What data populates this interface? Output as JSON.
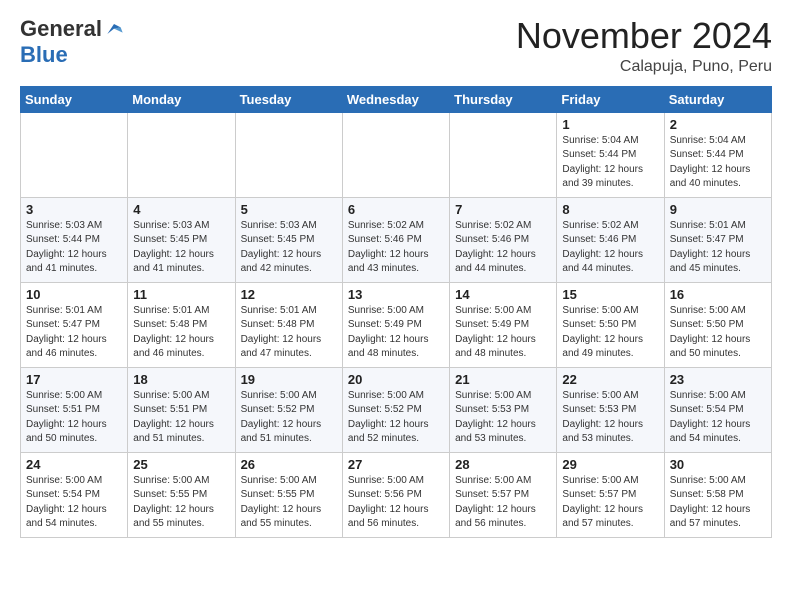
{
  "logo": {
    "general": "General",
    "blue": "Blue"
  },
  "header": {
    "month": "November 2024",
    "location": "Calapuja, Puno, Peru"
  },
  "weekdays": [
    "Sunday",
    "Monday",
    "Tuesday",
    "Wednesday",
    "Thursday",
    "Friday",
    "Saturday"
  ],
  "weeks": [
    [
      {
        "day": "",
        "info": ""
      },
      {
        "day": "",
        "info": ""
      },
      {
        "day": "",
        "info": ""
      },
      {
        "day": "",
        "info": ""
      },
      {
        "day": "",
        "info": ""
      },
      {
        "day": "1",
        "info": "Sunrise: 5:04 AM\nSunset: 5:44 PM\nDaylight: 12 hours\nand 39 minutes."
      },
      {
        "day": "2",
        "info": "Sunrise: 5:04 AM\nSunset: 5:44 PM\nDaylight: 12 hours\nand 40 minutes."
      }
    ],
    [
      {
        "day": "3",
        "info": "Sunrise: 5:03 AM\nSunset: 5:44 PM\nDaylight: 12 hours\nand 41 minutes."
      },
      {
        "day": "4",
        "info": "Sunrise: 5:03 AM\nSunset: 5:45 PM\nDaylight: 12 hours\nand 41 minutes."
      },
      {
        "day": "5",
        "info": "Sunrise: 5:03 AM\nSunset: 5:45 PM\nDaylight: 12 hours\nand 42 minutes."
      },
      {
        "day": "6",
        "info": "Sunrise: 5:02 AM\nSunset: 5:46 PM\nDaylight: 12 hours\nand 43 minutes."
      },
      {
        "day": "7",
        "info": "Sunrise: 5:02 AM\nSunset: 5:46 PM\nDaylight: 12 hours\nand 44 minutes."
      },
      {
        "day": "8",
        "info": "Sunrise: 5:02 AM\nSunset: 5:46 PM\nDaylight: 12 hours\nand 44 minutes."
      },
      {
        "day": "9",
        "info": "Sunrise: 5:01 AM\nSunset: 5:47 PM\nDaylight: 12 hours\nand 45 minutes."
      }
    ],
    [
      {
        "day": "10",
        "info": "Sunrise: 5:01 AM\nSunset: 5:47 PM\nDaylight: 12 hours\nand 46 minutes."
      },
      {
        "day": "11",
        "info": "Sunrise: 5:01 AM\nSunset: 5:48 PM\nDaylight: 12 hours\nand 46 minutes."
      },
      {
        "day": "12",
        "info": "Sunrise: 5:01 AM\nSunset: 5:48 PM\nDaylight: 12 hours\nand 47 minutes."
      },
      {
        "day": "13",
        "info": "Sunrise: 5:00 AM\nSunset: 5:49 PM\nDaylight: 12 hours\nand 48 minutes."
      },
      {
        "day": "14",
        "info": "Sunrise: 5:00 AM\nSunset: 5:49 PM\nDaylight: 12 hours\nand 48 minutes."
      },
      {
        "day": "15",
        "info": "Sunrise: 5:00 AM\nSunset: 5:50 PM\nDaylight: 12 hours\nand 49 minutes."
      },
      {
        "day": "16",
        "info": "Sunrise: 5:00 AM\nSunset: 5:50 PM\nDaylight: 12 hours\nand 50 minutes."
      }
    ],
    [
      {
        "day": "17",
        "info": "Sunrise: 5:00 AM\nSunset: 5:51 PM\nDaylight: 12 hours\nand 50 minutes."
      },
      {
        "day": "18",
        "info": "Sunrise: 5:00 AM\nSunset: 5:51 PM\nDaylight: 12 hours\nand 51 minutes."
      },
      {
        "day": "19",
        "info": "Sunrise: 5:00 AM\nSunset: 5:52 PM\nDaylight: 12 hours\nand 51 minutes."
      },
      {
        "day": "20",
        "info": "Sunrise: 5:00 AM\nSunset: 5:52 PM\nDaylight: 12 hours\nand 52 minutes."
      },
      {
        "day": "21",
        "info": "Sunrise: 5:00 AM\nSunset: 5:53 PM\nDaylight: 12 hours\nand 53 minutes."
      },
      {
        "day": "22",
        "info": "Sunrise: 5:00 AM\nSunset: 5:53 PM\nDaylight: 12 hours\nand 53 minutes."
      },
      {
        "day": "23",
        "info": "Sunrise: 5:00 AM\nSunset: 5:54 PM\nDaylight: 12 hours\nand 54 minutes."
      }
    ],
    [
      {
        "day": "24",
        "info": "Sunrise: 5:00 AM\nSunset: 5:54 PM\nDaylight: 12 hours\nand 54 minutes."
      },
      {
        "day": "25",
        "info": "Sunrise: 5:00 AM\nSunset: 5:55 PM\nDaylight: 12 hours\nand 55 minutes."
      },
      {
        "day": "26",
        "info": "Sunrise: 5:00 AM\nSunset: 5:55 PM\nDaylight: 12 hours\nand 55 minutes."
      },
      {
        "day": "27",
        "info": "Sunrise: 5:00 AM\nSunset: 5:56 PM\nDaylight: 12 hours\nand 56 minutes."
      },
      {
        "day": "28",
        "info": "Sunrise: 5:00 AM\nSunset: 5:57 PM\nDaylight: 12 hours\nand 56 minutes."
      },
      {
        "day": "29",
        "info": "Sunrise: 5:00 AM\nSunset: 5:57 PM\nDaylight: 12 hours\nand 57 minutes."
      },
      {
        "day": "30",
        "info": "Sunrise: 5:00 AM\nSunset: 5:58 PM\nDaylight: 12 hours\nand 57 minutes."
      }
    ]
  ]
}
